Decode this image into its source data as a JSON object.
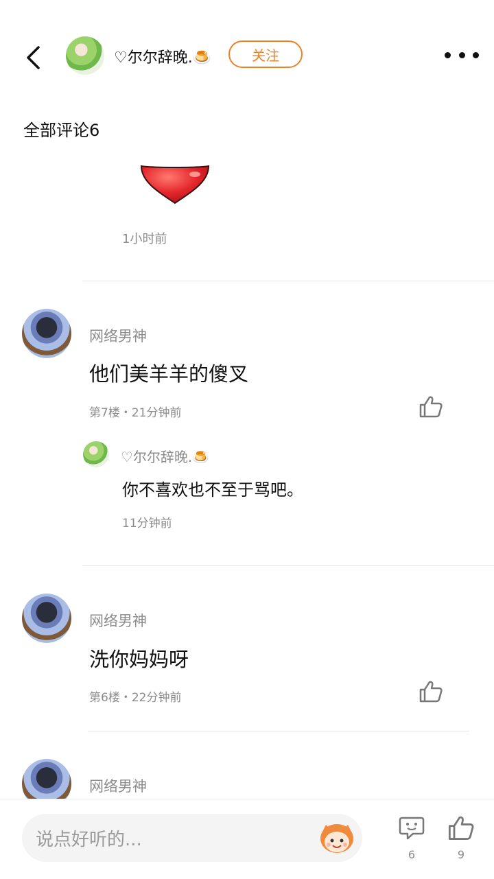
{
  "header": {
    "author_name": "♡尔尔辞晚.🍮",
    "follow_label": "关注"
  },
  "section": {
    "title": "全部评论6"
  },
  "partial_comment": {
    "time": "1小时前"
  },
  "comments": [
    {
      "user": "网络男神",
      "text": "他们美羊羊的傻叉",
      "meta": "第7楼・21分钟前",
      "reply": {
        "user": "♡尔尔辞晚.🍮",
        "text": "你不喜欢也不至于骂吧。",
        "time": "11分钟前"
      }
    },
    {
      "user": "网络男神",
      "text": "洗你妈妈呀",
      "meta": "第6楼・22分钟前"
    },
    {
      "user": "网络男神"
    }
  ],
  "bottom_bar": {
    "input_placeholder": "说点好听的...",
    "comment_count": "6",
    "like_count": "9"
  },
  "colors": {
    "accent": "#f08124",
    "muted_text": "#8b8b8b",
    "heart": "#e4262b"
  },
  "icons": [
    "back-arrow-icon",
    "more-dots-icon",
    "heart-emoji-icon",
    "thumb-up-icon",
    "comment-bubble-icon",
    "mascot-emoji-icon"
  ]
}
